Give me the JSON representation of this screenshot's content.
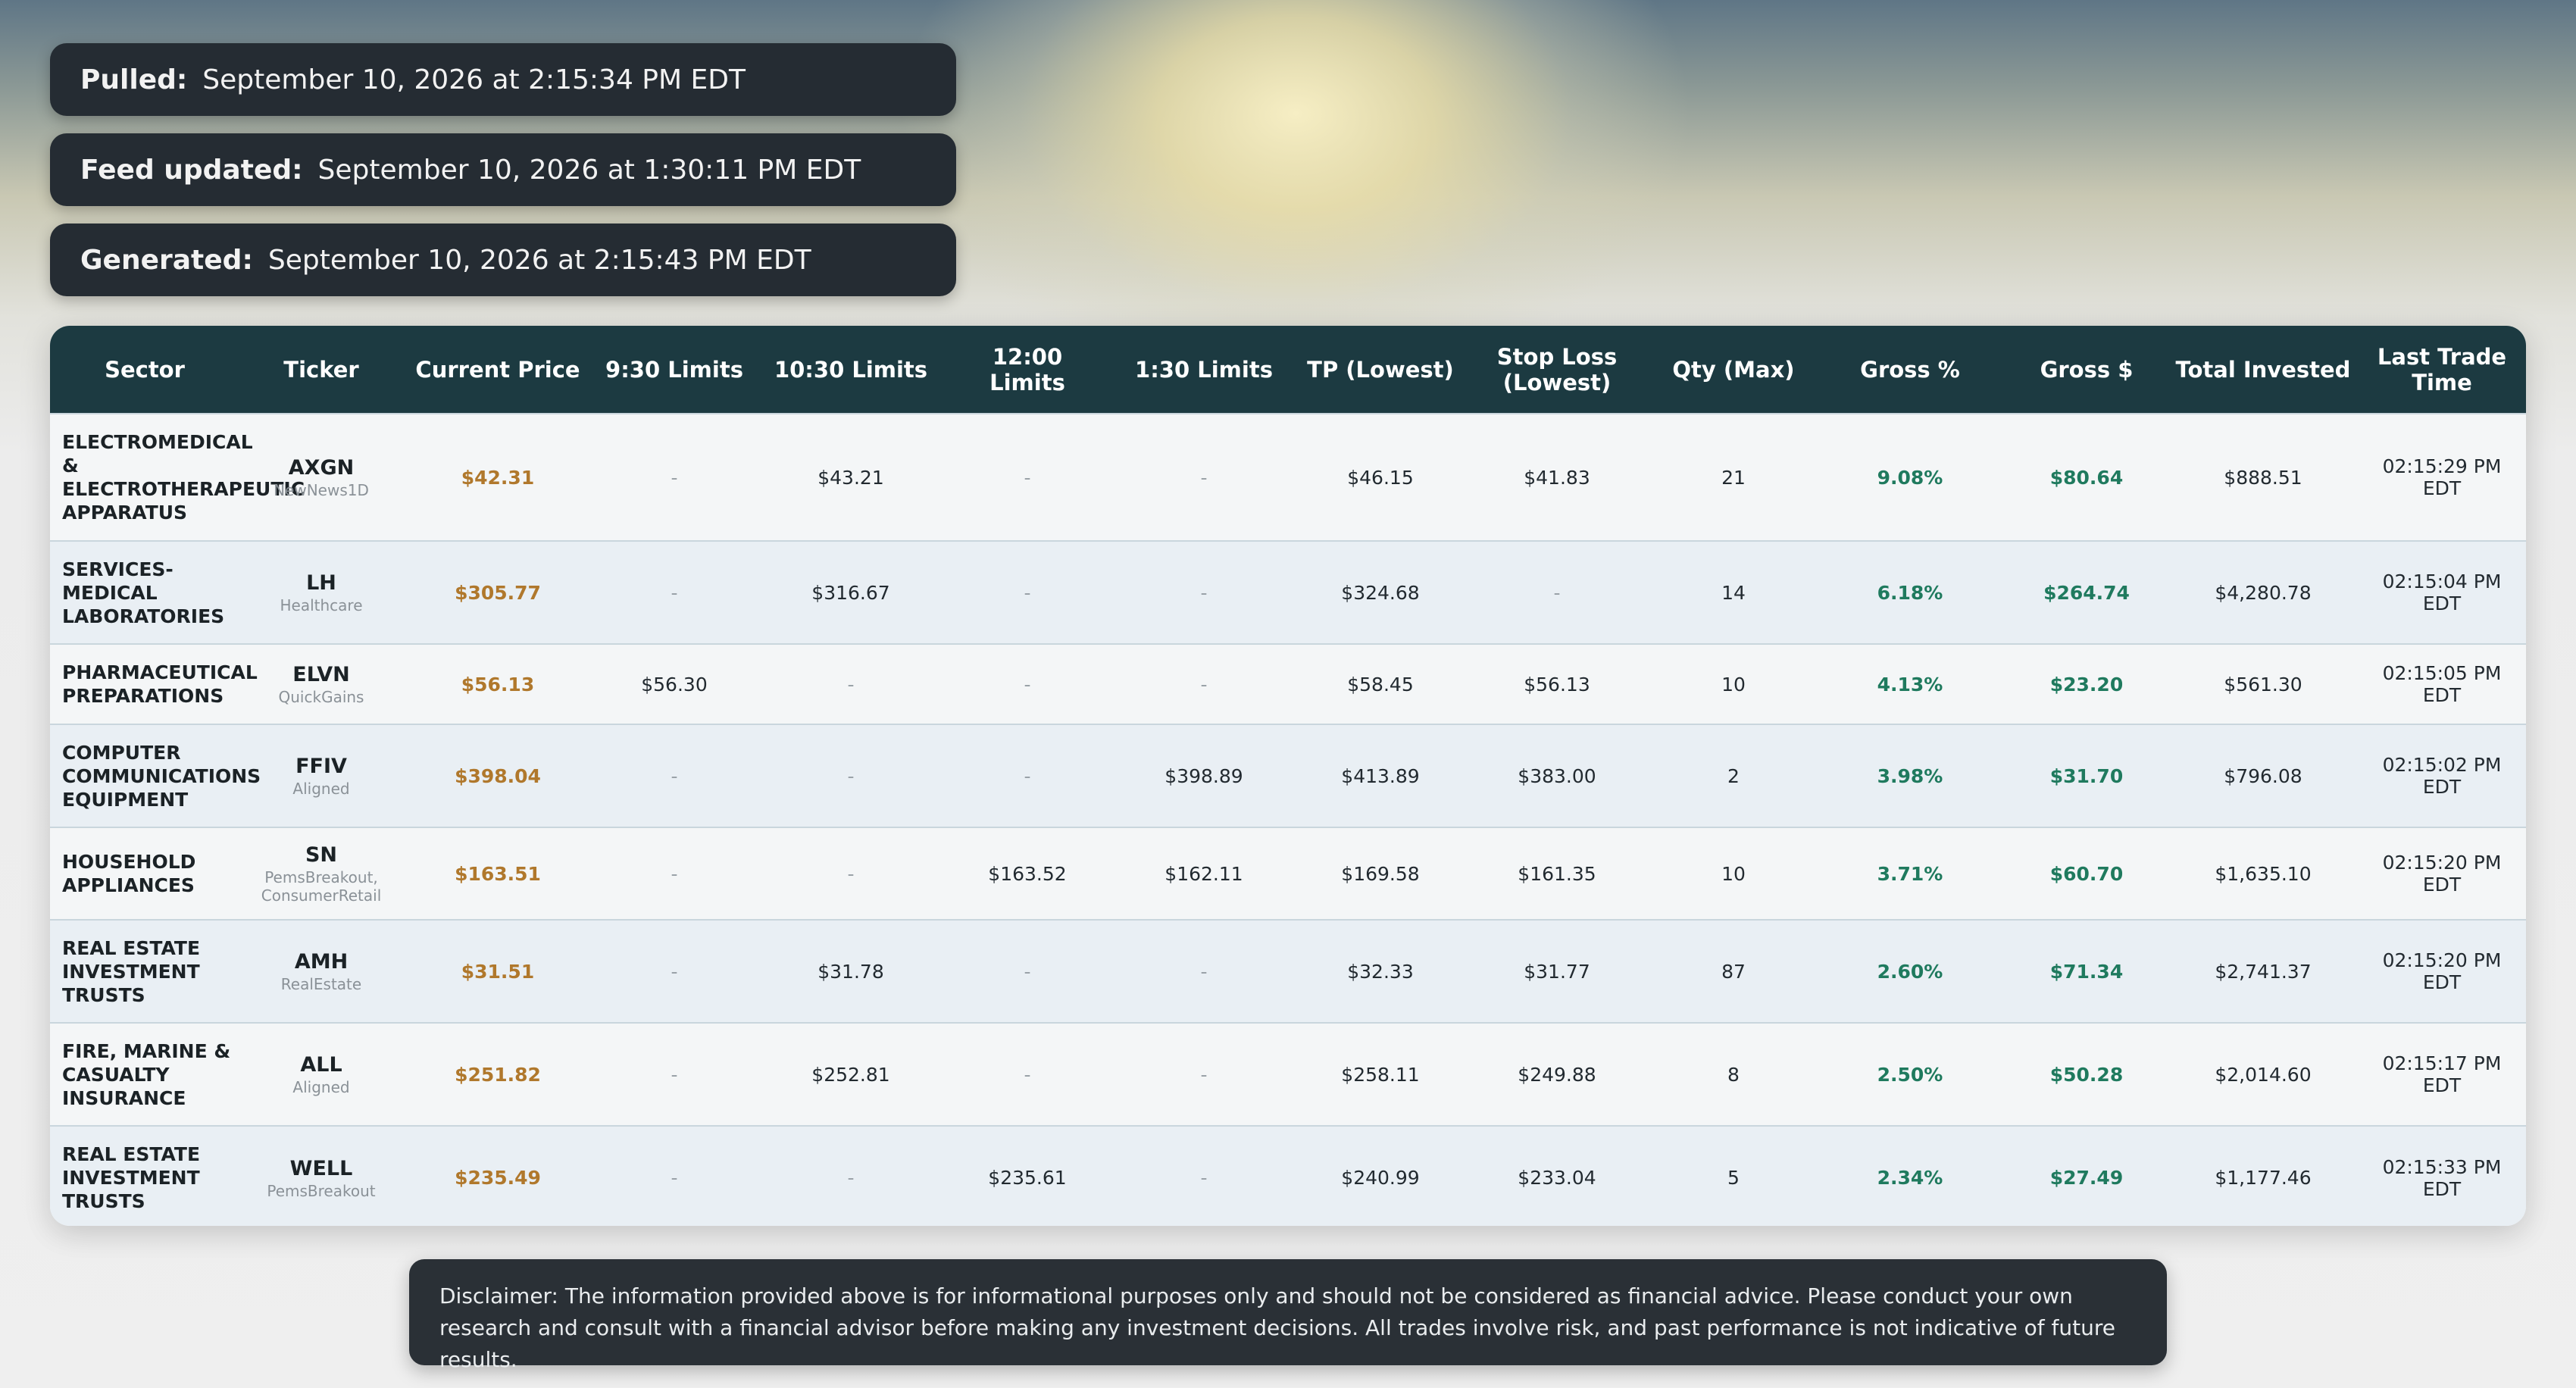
{
  "info": {
    "pulled_label": "Pulled:",
    "pulled_value": "September 10, 2026 at 2:15:34 PM EDT",
    "feed_label": "Feed updated:",
    "feed_value": "September 10, 2026 at 1:30:11 PM EDT",
    "generated_label": "Generated:",
    "generated_value": "September 10, 2026 at 2:15:43 PM EDT"
  },
  "table": {
    "headers": [
      "Sector",
      "Ticker",
      "Current Price",
      "9:30 Limits",
      "10:30 Limits",
      "12:00 Limits",
      "1:30 Limits",
      "TP (Lowest)",
      "Stop Loss (Lowest)",
      "Qty (Max)",
      "Gross %",
      "Gross $",
      "Total Invested",
      "Last Trade Time"
    ],
    "rows": [
      {
        "sector": "ELECTROMEDICAL & ELECTROTHERAPEUTIC APPARATUS",
        "ticker": "AXGN",
        "tag": "NewNews1D",
        "price": "$42.31",
        "l930": "-",
        "l1030": "$43.21",
        "l1200": "-",
        "l130": "-",
        "tp": "$46.15",
        "sl": "$41.83",
        "qty": "21",
        "gross_pct": "9.08%",
        "gross_usd": "$80.64",
        "invested": "$888.51",
        "time": "02:15:29 PM EDT"
      },
      {
        "sector": "SERVICES-MEDICAL LABORATORIES",
        "ticker": "LH",
        "tag": "Healthcare",
        "price": "$305.77",
        "l930": "-",
        "l1030": "$316.67",
        "l1200": "-",
        "l130": "-",
        "tp": "$324.68",
        "sl": "-",
        "qty": "14",
        "gross_pct": "6.18%",
        "gross_usd": "$264.74",
        "invested": "$4,280.78",
        "time": "02:15:04 PM EDT"
      },
      {
        "sector": "PHARMACEUTICAL PREPARATIONS",
        "ticker": "ELVN",
        "tag": "QuickGains",
        "price": "$56.13",
        "l930": "$56.30",
        "l1030": "-",
        "l1200": "-",
        "l130": "-",
        "tp": "$58.45",
        "sl": "$56.13",
        "qty": "10",
        "gross_pct": "4.13%",
        "gross_usd": "$23.20",
        "invested": "$561.30",
        "time": "02:15:05 PM EDT"
      },
      {
        "sector": "COMPUTER COMMUNICATIONS EQUIPMENT",
        "ticker": "FFIV",
        "tag": "Aligned",
        "price": "$398.04",
        "l930": "-",
        "l1030": "-",
        "l1200": "-",
        "l130": "$398.89",
        "tp": "$413.89",
        "sl": "$383.00",
        "qty": "2",
        "gross_pct": "3.98%",
        "gross_usd": "$31.70",
        "invested": "$796.08",
        "time": "02:15:02 PM EDT"
      },
      {
        "sector": "HOUSEHOLD APPLIANCES",
        "ticker": "SN",
        "tag": "PemsBreakout, ConsumerRetail",
        "price": "$163.51",
        "l930": "-",
        "l1030": "-",
        "l1200": "$163.52",
        "l130": "$162.11",
        "tp": "$169.58",
        "sl": "$161.35",
        "qty": "10",
        "gross_pct": "3.71%",
        "gross_usd": "$60.70",
        "invested": "$1,635.10",
        "time": "02:15:20 PM EDT"
      },
      {
        "sector": "REAL ESTATE INVESTMENT TRUSTS",
        "ticker": "AMH",
        "tag": "RealEstate",
        "price": "$31.51",
        "l930": "-",
        "l1030": "$31.78",
        "l1200": "-",
        "l130": "-",
        "tp": "$32.33",
        "sl": "$31.77",
        "qty": "87",
        "gross_pct": "2.60%",
        "gross_usd": "$71.34",
        "invested": "$2,741.37",
        "time": "02:15:20 PM EDT"
      },
      {
        "sector": "FIRE, MARINE & CASUALTY INSURANCE",
        "ticker": "ALL",
        "tag": "Aligned",
        "price": "$251.82",
        "l930": "-",
        "l1030": "$252.81",
        "l1200": "-",
        "l130": "-",
        "tp": "$258.11",
        "sl": "$249.88",
        "qty": "8",
        "gross_pct": "2.50%",
        "gross_usd": "$50.28",
        "invested": "$2,014.60",
        "time": "02:15:17 PM EDT"
      },
      {
        "sector": "REAL ESTATE INVESTMENT TRUSTS",
        "ticker": "WELL",
        "tag": "PemsBreakout",
        "price": "$235.49",
        "l930": "-",
        "l1030": "-",
        "l1200": "$235.61",
        "l130": "-",
        "tp": "$240.99",
        "sl": "$233.04",
        "qty": "5",
        "gross_pct": "2.34%",
        "gross_usd": "$27.49",
        "invested": "$1,177.46",
        "time": "02:15:33 PM EDT"
      }
    ]
  },
  "disclaimer": "Disclaimer: The information provided above is for informational purposes only and should not be considered as financial advice. Please conduct your own research and consult with a financial advisor before making any investment decisions. All trades involve risk, and past performance is not indicative of future results.",
  "colors": {
    "price": "#b0782c",
    "positive": "#1f7a5e",
    "header_bg": "#1c3a41",
    "panel_bg": "#252c33"
  }
}
